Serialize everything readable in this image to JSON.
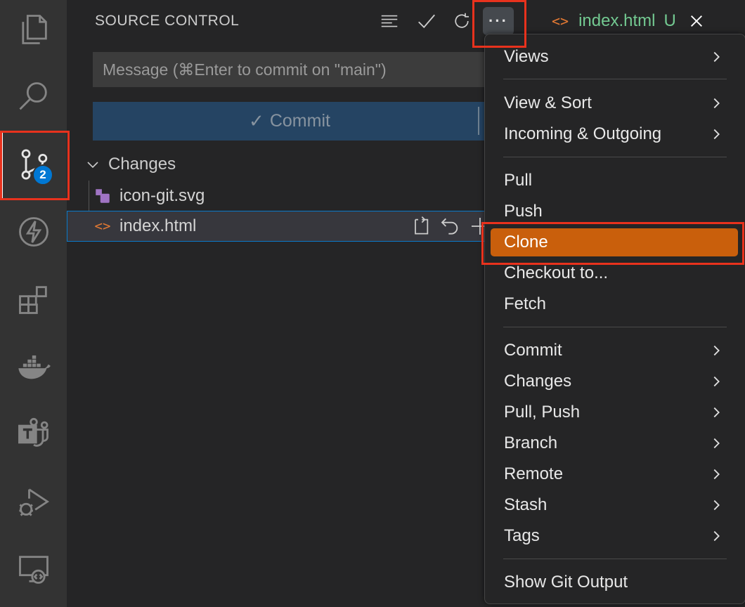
{
  "sidebar": {
    "header_title": "SOURCE CONTROL",
    "badge_count": "2",
    "commit_input": {
      "placeholder": "Message (⌘Enter to commit on \"main\")",
      "value": ""
    },
    "commit_button_label": "Commit",
    "changes_header": "Changes",
    "files": [
      {
        "name": "icon-git.svg"
      },
      {
        "name": "index.html"
      }
    ]
  },
  "editor_tab": {
    "code_icon": "<>",
    "label": "index.html",
    "status": "U"
  },
  "menu": {
    "items": [
      {
        "label": "Views",
        "submenu": true
      },
      {
        "label": "View & Sort",
        "submenu": true
      },
      {
        "label": "Incoming & Outgoing",
        "submenu": true
      },
      {
        "label": "Pull",
        "submenu": false
      },
      {
        "label": "Push",
        "submenu": false
      },
      {
        "label": "Clone",
        "submenu": false,
        "highlighted": true
      },
      {
        "label": "Checkout to...",
        "submenu": false
      },
      {
        "label": "Fetch",
        "submenu": false
      },
      {
        "label": "Commit",
        "submenu": true
      },
      {
        "label": "Changes",
        "submenu": true
      },
      {
        "label": "Pull, Push",
        "submenu": true
      },
      {
        "label": "Branch",
        "submenu": true
      },
      {
        "label": "Remote",
        "submenu": true
      },
      {
        "label": "Stash",
        "submenu": true
      },
      {
        "label": "Tags",
        "submenu": true
      },
      {
        "label": "Show Git Output",
        "submenu": false
      }
    ]
  },
  "colors": {
    "accent_badge": "#0078d4",
    "menu_highlight": "#c95f0c",
    "annotation_box": "#e8321d",
    "untracked_green": "#73c991"
  }
}
